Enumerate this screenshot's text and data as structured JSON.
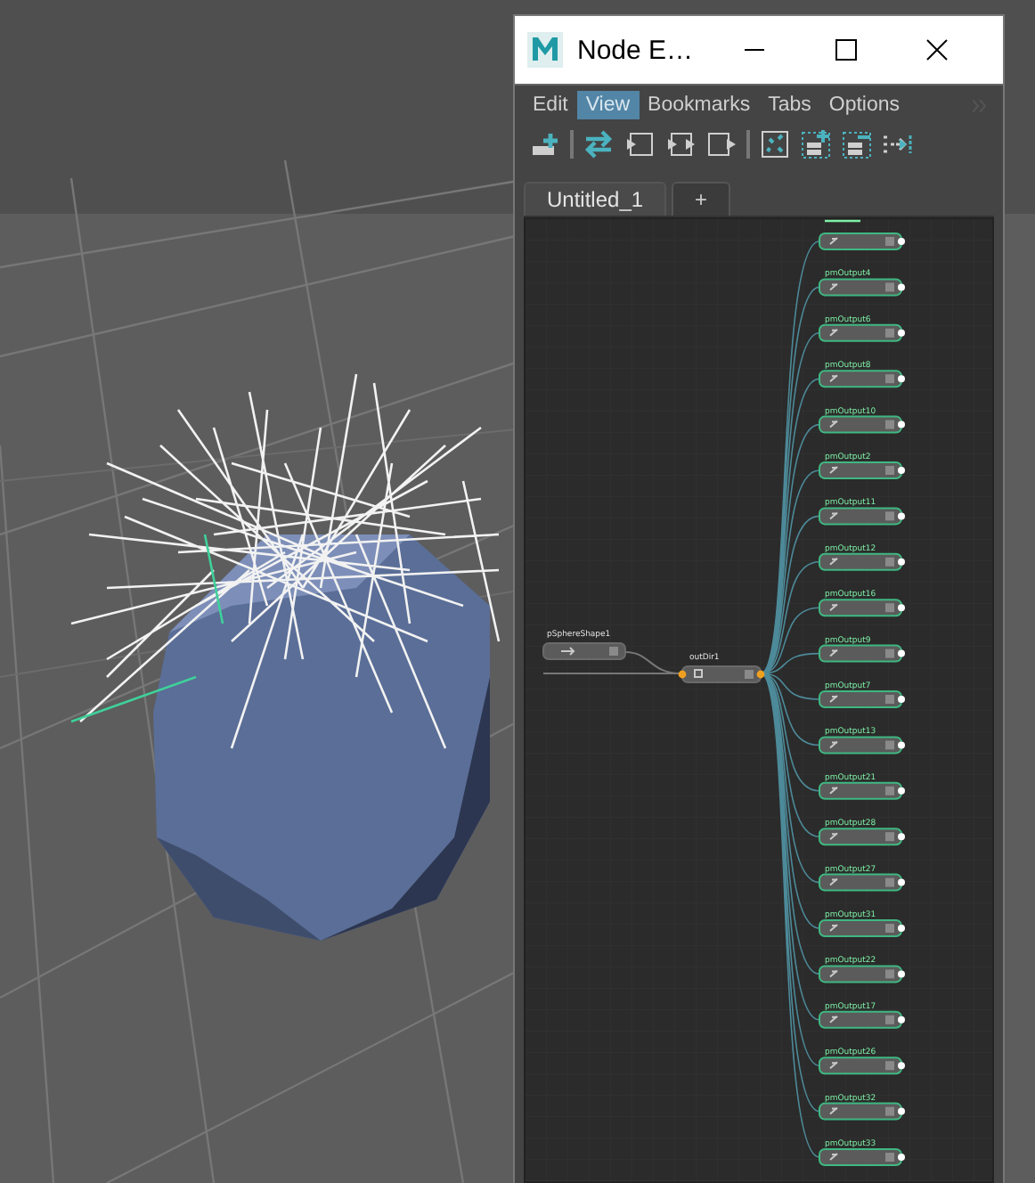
{
  "window": {
    "title": "Node E…"
  },
  "menu": [
    {
      "label": "Edit",
      "selected": false
    },
    {
      "label": "View",
      "selected": true
    },
    {
      "label": "Bookmarks",
      "selected": false
    },
    {
      "label": "Tabs",
      "selected": false
    },
    {
      "label": "Options",
      "selected": false
    }
  ],
  "tabs": [
    {
      "label": "Untitled_1",
      "selected": true
    },
    {
      "label": "+",
      "selected": false
    }
  ],
  "graph": {
    "source_node": {
      "label": "pSphereShape1"
    },
    "middle_node": {
      "label": "outDir1"
    },
    "output_nodes": [
      {
        "kind": "clipped"
      },
      {
        "label": "pmOutput4"
      },
      {
        "label": "pmOutput6"
      },
      {
        "label": "pmOutput8"
      },
      {
        "label": "pmOutput10"
      },
      {
        "label": "pmOutput2"
      },
      {
        "label": "pmOutput11"
      },
      {
        "label": "pmOutput12"
      },
      {
        "label": "pmOutput16"
      },
      {
        "label": "pmOutput9"
      },
      {
        "label": "pmOutput7"
      },
      {
        "label": "pmOutput13"
      },
      {
        "label": "pmOutput21"
      },
      {
        "label": "pmOutput28"
      },
      {
        "label": "pmOutput27"
      },
      {
        "label": "pmOutput31"
      },
      {
        "label": "pmOutput22"
      },
      {
        "label": "pmOutput17"
      },
      {
        "label": "pmOutput26"
      },
      {
        "label": "pmOutput32"
      },
      {
        "label": "pmOutput33"
      }
    ]
  }
}
